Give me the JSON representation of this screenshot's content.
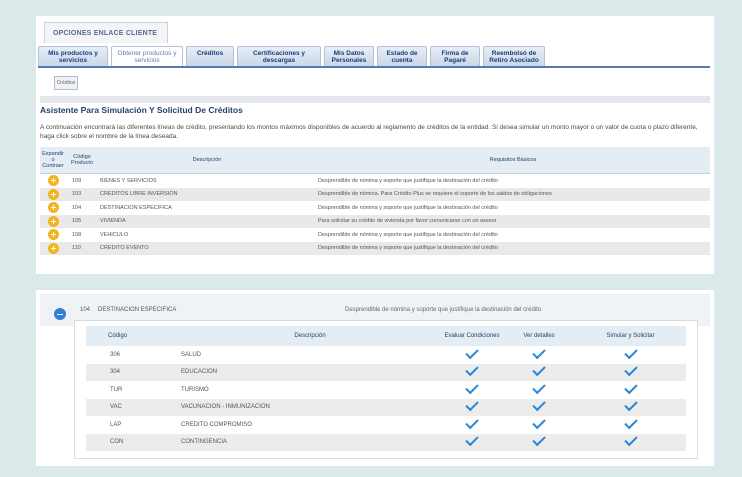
{
  "top_tab": "OPCIONES ENLACE CLIENTE",
  "nav_tabs": [
    {
      "label": "Mis productos y servicios",
      "active": false
    },
    {
      "label": "Obtener productos y servicios",
      "active": true
    },
    {
      "label": "Créditos",
      "active": false
    },
    {
      "label": "Certificaciones y descargas",
      "active": false
    },
    {
      "label": "Mis Datos Personales",
      "active": false
    },
    {
      "label": "Estado de cuenta",
      "active": false
    },
    {
      "label": "Firma de Pagaré",
      "active": false
    },
    {
      "label": "Reembolsó de Retiro Asociado",
      "active": false
    }
  ],
  "sub_button": "Créditos",
  "section_title": "Asistente Para Simulación Y Solicitud De Créditos",
  "intro_text": "A continuación encontrará las diferentes líneas de crédito, presentando los montos máximos disponibles de acuerdo al reglamento de créditos de la entidad. Si desea simular un monto mayor o un valor de cuota o plazo diferente, haga click sobre el nombre de la línea deseada.",
  "credit_table": {
    "headers": [
      "Expandir o Contraer",
      "Código Producto",
      "Descripción",
      "Requisitos Básicos"
    ],
    "rows": [
      {
        "code": "109",
        "description": "BIENES Y SERVICIOS",
        "requirements": "Desprendible de nómina y soporte que justifique la destinación del crédito"
      },
      {
        "code": "103",
        "description": "CREDITOS LIBRE INVERSION",
        "requirements": "Desprendible de nómina. Para Crédito Plus se requiere el soporte de los saldos de obligaciones"
      },
      {
        "code": "104",
        "description": "DESTINACION ESPECIFICA",
        "requirements": "Desprendible de nómina y soporte que justifique la destinación del crédito"
      },
      {
        "code": "105",
        "description": "VIVIENDA",
        "requirements": "Para solicitar su crédito de vivienda por favor comunicarse con un asesor"
      },
      {
        "code": "108",
        "description": "VEHICULO",
        "requirements": "Desprendible de nómina y soporte que justifique la destinación del crédito"
      },
      {
        "code": "110",
        "description": "CREDITO EVENTO",
        "requirements": "Desprendible de nómina y soporte que justifique la destinación del crédito"
      }
    ]
  },
  "expanded": {
    "code": "104",
    "description": "DESTINACION ESPECIFICA",
    "requirements": "Desprendible de nómina y soporte que justifique la destinación del crédito",
    "headers": [
      "Código",
      "Descripción",
      "Evaluar Condiciones",
      "Ver detalles",
      "Simular y Solicitar"
    ],
    "rows": [
      {
        "code": "306",
        "description": "SALUD"
      },
      {
        "code": "304",
        "description": "EDUCACION"
      },
      {
        "code": "TUR",
        "description": "TURISMO"
      },
      {
        "code": "VAC",
        "description": "VACUNACION - INMUNIZACION"
      },
      {
        "code": "LAP",
        "description": "CREDITO COMPROMISO"
      },
      {
        "code": "CON",
        "description": "CONTINGENCIA"
      }
    ]
  }
}
